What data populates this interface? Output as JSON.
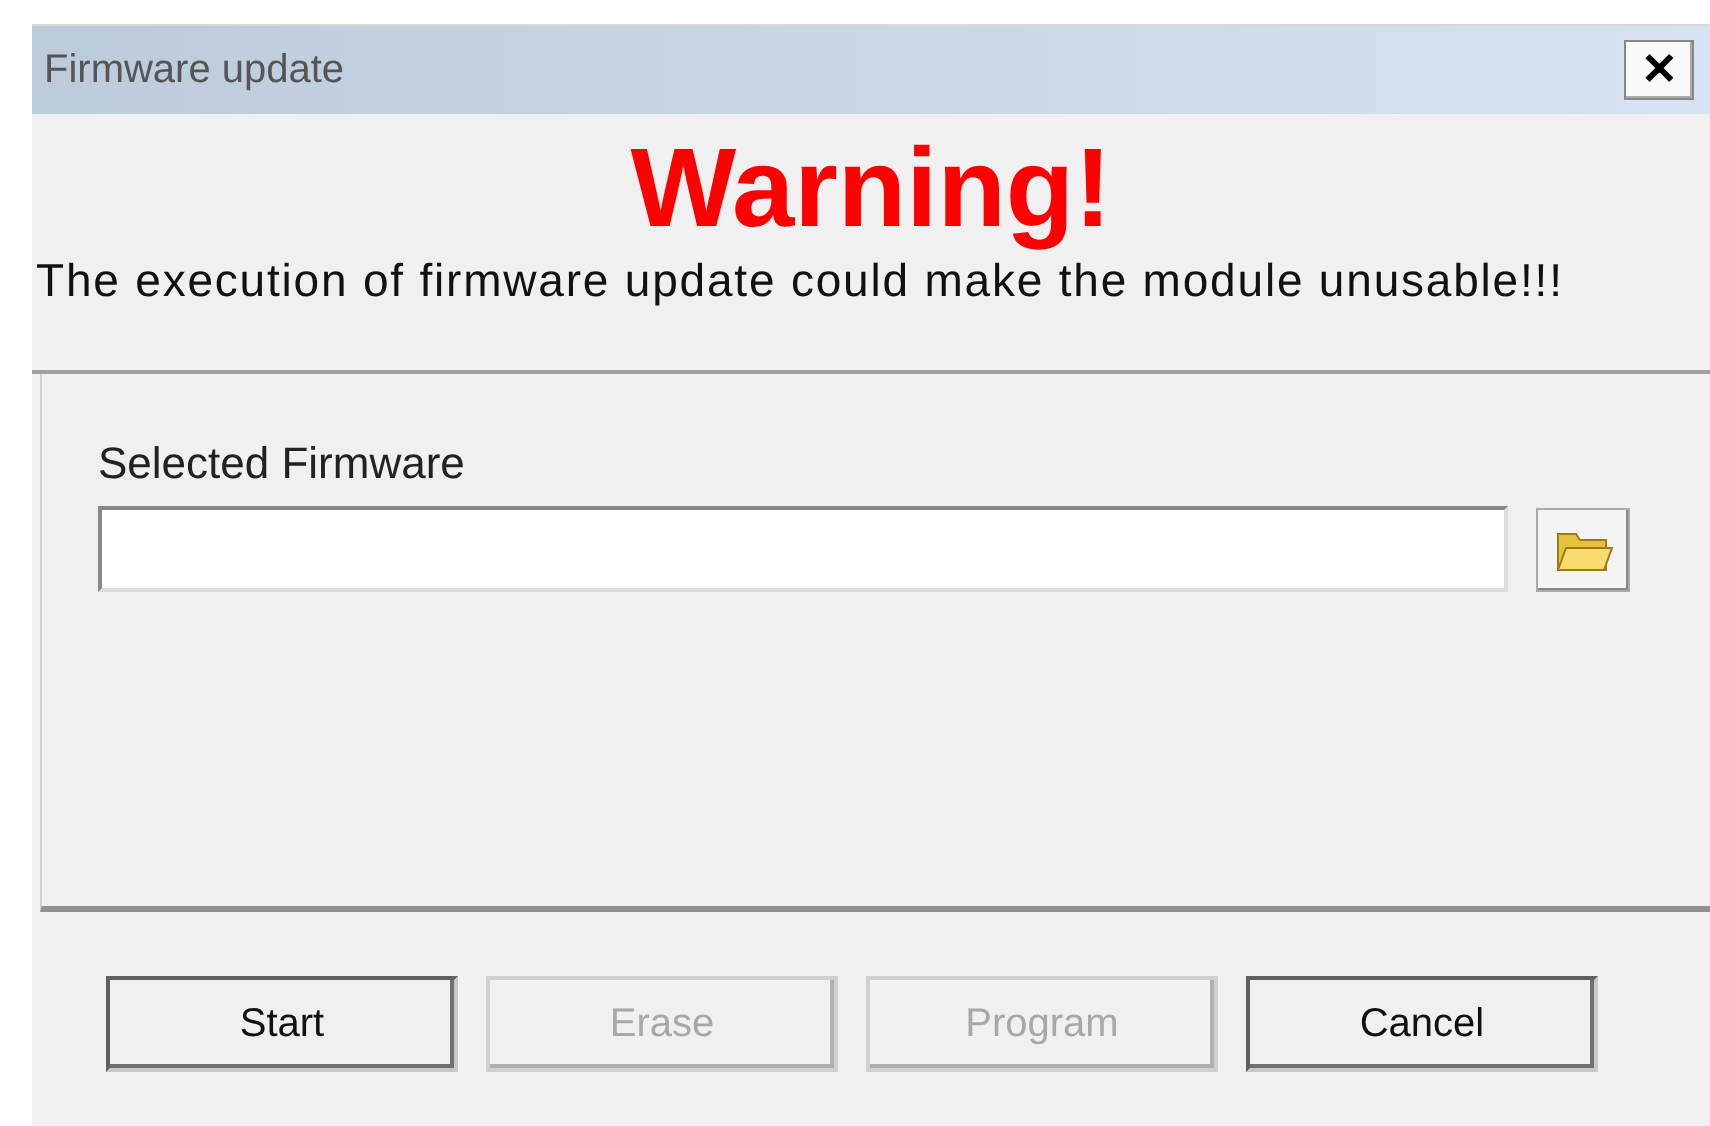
{
  "window": {
    "title": "Firmware update",
    "close": "✕"
  },
  "warning": {
    "heading": "Warning!",
    "message": "The execution of firmware update could make the module unusable!!!"
  },
  "firmware": {
    "label": "Selected Firmware"
  },
  "buttons": [
    {
      "label": "Start",
      "disabled": false
    },
    {
      "label": "Erase",
      "disabled": true
    },
    {
      "label": "Program",
      "disabled": true
    },
    {
      "label": "Cancel",
      "disabled": false
    }
  ]
}
